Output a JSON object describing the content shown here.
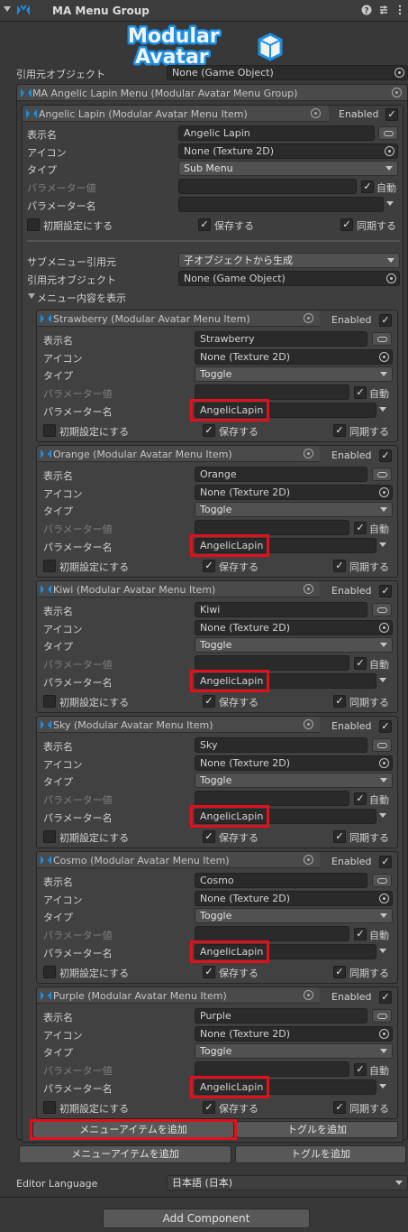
{
  "header": {
    "title": "MA Menu Group",
    "help_icon": "help-icon",
    "settings_icon": "preset-icon",
    "menu_icon": "kebab-icon"
  },
  "logo": {
    "line1": "Modular",
    "line2": "Avatar"
  },
  "group": {
    "source_label": "引用元オブジェクト",
    "source_value": "None (Game Object)",
    "box_title": "MA Angelic Lapin Menu (Modular Avatar Menu Group)"
  },
  "main_item": {
    "title": "Angelic Lapin (Modular Avatar Menu Item)",
    "enabled_label": "Enabled",
    "enabled": true,
    "display_name_label": "表示名",
    "display_name": "Angelic Lapin",
    "icon_label": "アイコン",
    "icon_value": "None (Texture 2D)",
    "type_label": "タイプ",
    "type_value": "Sub Menu",
    "param_value_label": "パラメーター値",
    "auto_label": "自動",
    "param_name_label": "パラメーター名",
    "default_label": "初期設定にする",
    "save_label": "保存する",
    "sync_label": "同期する",
    "submenu_source_label": "サブメニュー引用元",
    "submenu_source_value": "子オブジェクトから生成",
    "source_object_label": "引用元オブジェクト",
    "source_object_value": "None (Game Object)",
    "show_contents_label": "メニュー内容を表示"
  },
  "item_labels": {
    "enabled": "Enabled",
    "display_name": "表示名",
    "icon": "アイコン",
    "type": "タイプ",
    "param_value": "パラメーター値",
    "auto": "自動",
    "param_name": "パラメーター名",
    "default": "初期設定にする",
    "save": "保存する",
    "sync": "同期する",
    "icon_value": "None (Texture 2D)",
    "type_value": "Toggle",
    "param_name_value": "AngelicLapin"
  },
  "items": [
    {
      "title": "Strawberry (Modular Avatar Menu Item)",
      "name": "Strawberry"
    },
    {
      "title": "Orange (Modular Avatar Menu Item)",
      "name": "Orange"
    },
    {
      "title": "Kiwi (Modular Avatar Menu Item)",
      "name": "Kiwi"
    },
    {
      "title": "Sky (Modular Avatar Menu Item)",
      "name": "Sky"
    },
    {
      "title": "Cosmo (Modular Avatar Menu Item)",
      "name": "Cosmo"
    },
    {
      "title": "Purple (Modular Avatar Menu Item)",
      "name": "Purple"
    }
  ],
  "buttons": {
    "add_menu_item": "メニューアイテムを追加",
    "add_toggle": "トグルを追加",
    "add_component": "Add Component"
  },
  "editor_language": {
    "label": "Editor Language",
    "value": "日本語 (日本)"
  },
  "colors": {
    "highlight": "#e0101c",
    "logo_blue": "#1a8fe3"
  }
}
